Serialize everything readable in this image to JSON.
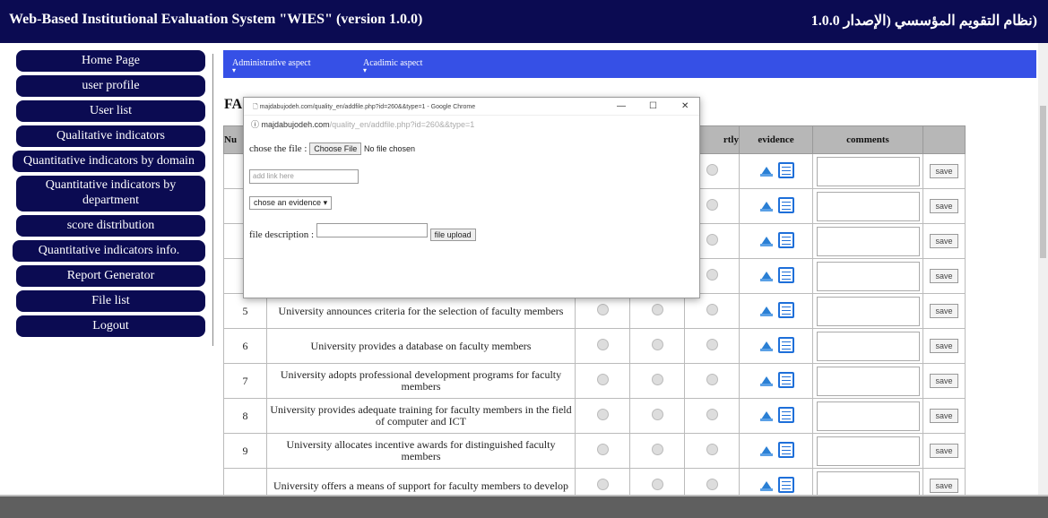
{
  "header": {
    "title_en": "Web-Based Institutional Evaluation System \"WIES\" (version 1.0.0)",
    "title_ar": "(نظام التقويم المؤسسي (الإصدار 1.0.0"
  },
  "sidebar": {
    "items": [
      {
        "label": "Home Page"
      },
      {
        "label": "user profile"
      },
      {
        "label": "User list"
      },
      {
        "label": "Qualitative indicators"
      },
      {
        "label": "Quantitative indicators by domain"
      },
      {
        "label": "Quantitative indicators by department"
      },
      {
        "label": "score distribution"
      },
      {
        "label": "Quantitative indicators info."
      },
      {
        "label": "Report Generator"
      },
      {
        "label": "File list"
      },
      {
        "label": "Logout"
      }
    ]
  },
  "topnav": {
    "items": [
      {
        "label": "Administrative aspect"
      },
      {
        "label": "Acadimic aspect"
      }
    ]
  },
  "section_title": "FA",
  "table": {
    "headers": {
      "num": "Nu",
      "rad3": "rtly",
      "evidence": "evidence",
      "comments": "comments"
    },
    "save_label": "save",
    "rows": [
      {
        "num": "",
        "indicator": ""
      },
      {
        "num": "",
        "indicator": ""
      },
      {
        "num": "",
        "indicator": ""
      },
      {
        "num": "",
        "indicator": ""
      },
      {
        "num": "5",
        "indicator": "University announces criteria for the selection of faculty members"
      },
      {
        "num": "6",
        "indicator": "University provides a database on faculty members"
      },
      {
        "num": "7",
        "indicator": "University adopts professional development programs for faculty members"
      },
      {
        "num": "8",
        "indicator": "University provides adequate training for faculty members in the field of computer and ICT"
      },
      {
        "num": "9",
        "indicator": "University allocates incentive awards for distinguished faculty members"
      },
      {
        "num": "",
        "indicator": "University offers a means of support for faculty members to develop"
      }
    ]
  },
  "popup": {
    "window_title": "majdabujodeh.com/quality_en/addfile.php?id=260&&type=1 - Google Chrome",
    "url_host": "majdabujodeh.com",
    "url_path": "/quality_en/addfile.php?id=260&&type=1",
    "min_glyph": "—",
    "max_glyph": "☐",
    "close_glyph": "✕",
    "choose_label": "chose the file :",
    "choose_button": "Choose File",
    "no_file": "No file chosen",
    "link_placeholder": "add link here",
    "evidence_select": "chose an evidence",
    "desc_label": "file description :",
    "upload_button": "file upload"
  },
  "colors": {
    "header_bg": "#0b0b52",
    "nav_bg": "#3650e6",
    "table_head": "#b7b7b7"
  }
}
